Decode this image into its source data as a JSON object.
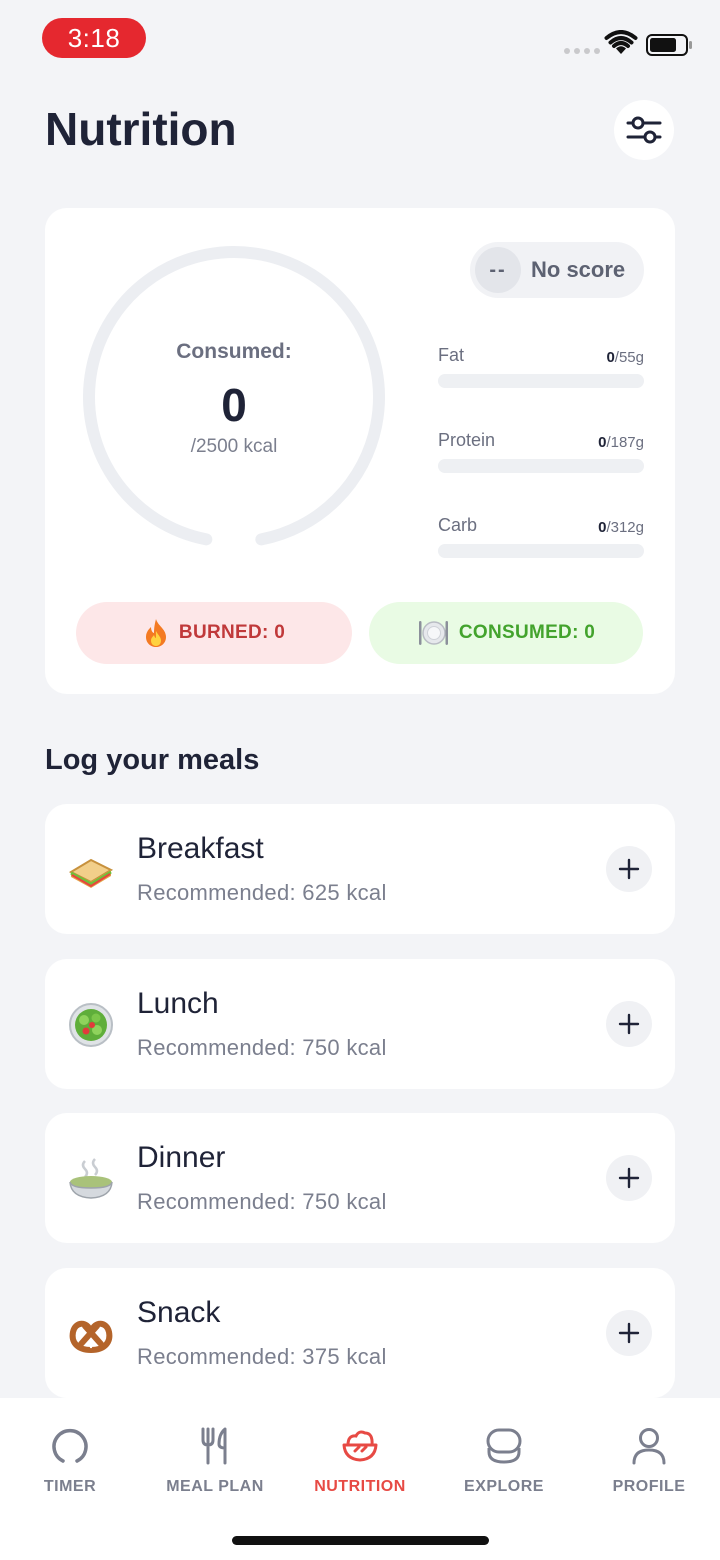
{
  "status": {
    "time": "3:18"
  },
  "header": {
    "title": "Nutrition",
    "filter_icon": "sliders-icon"
  },
  "summary": {
    "ring_label": "Consumed:",
    "consumed_value": "0",
    "goal_text": "/2500 kcal",
    "consumed_fraction": 0,
    "score": {
      "dash": "--",
      "text": "No score"
    },
    "macros": [
      {
        "name": "Fat",
        "value": "0",
        "goal": "/55g",
        "fraction": 0
      },
      {
        "name": "Protein",
        "value": "0",
        "goal": "/187g",
        "fraction": 0
      },
      {
        "name": "Carb",
        "value": "0",
        "goal": "/312g",
        "fraction": 0
      }
    ],
    "burned_label": "BURNED: 0",
    "consumed_label": "CONSUMED: 0"
  },
  "meals": {
    "section_title": "Log your meals",
    "items": [
      {
        "name": "Breakfast",
        "recommended": "Recommended: 625 kcal",
        "icon": "sandwich-icon"
      },
      {
        "name": "Lunch",
        "recommended": "Recommended: 750 kcal",
        "icon": "salad-icon"
      },
      {
        "name": "Dinner",
        "recommended": "Recommended: 750 kcal",
        "icon": "soup-icon"
      },
      {
        "name": "Snack",
        "recommended": "Recommended: 375 kcal",
        "icon": "pretzel-icon"
      }
    ]
  },
  "nav": {
    "items": [
      {
        "label": "TIMER",
        "icon": "timer-icon",
        "active": false
      },
      {
        "label": "MEAL PLAN",
        "icon": "fork-knife-icon",
        "active": false
      },
      {
        "label": "NUTRITION",
        "icon": "bowl-icon",
        "active": true
      },
      {
        "label": "EXPLORE",
        "icon": "explore-icon",
        "active": false
      },
      {
        "label": "PROFILE",
        "icon": "person-icon",
        "active": false
      }
    ]
  },
  "colors": {
    "accent": "#e74a44",
    "burned_bg": "#fde7e8",
    "consumed_bg": "#e9fbe4"
  }
}
